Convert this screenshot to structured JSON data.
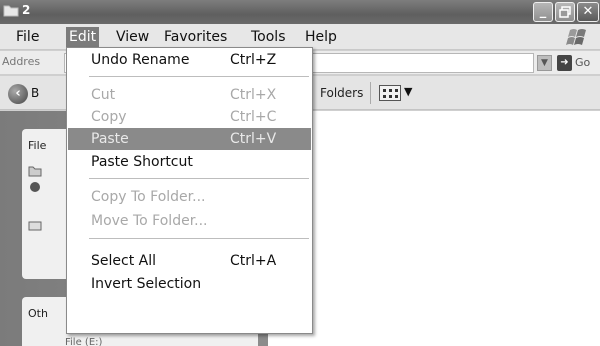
{
  "window": {
    "title": "2"
  },
  "menubar": {
    "items": [
      "File",
      "Edit",
      "View",
      "Favorites",
      "Tools",
      "Help"
    ],
    "active": "Edit"
  },
  "address": {
    "label": "Addres",
    "value": "",
    "go_label": "Go"
  },
  "toolbar": {
    "back_label": "B",
    "folders_label": "Folders"
  },
  "left_pane": {
    "file_tasks_header": "File",
    "other_places_header": "Oth",
    "drive_label": "File (E:)"
  },
  "edit_menu": {
    "items": [
      {
        "label": "Undo Rename",
        "shortcut": "Ctrl+Z",
        "enabled": true
      },
      {
        "label": "Cut",
        "shortcut": "Ctrl+X",
        "enabled": false
      },
      {
        "label": "Copy",
        "shortcut": "Ctrl+C",
        "enabled": false
      },
      {
        "label": "Paste",
        "shortcut": "Ctrl+V",
        "enabled": true,
        "highlighted": true
      },
      {
        "label": "Paste Shortcut",
        "shortcut": "",
        "enabled": true
      },
      {
        "label": "Copy To Folder...",
        "shortcut": "",
        "enabled": false
      },
      {
        "label": "Move To Folder...",
        "shortcut": "",
        "enabled": false
      },
      {
        "label": "Select All",
        "shortcut": "Ctrl+A",
        "enabled": true
      },
      {
        "label": "Invert Selection",
        "shortcut": "",
        "enabled": true
      }
    ]
  },
  "icons": {
    "title": "folder-icon",
    "min": "minimize-icon",
    "max": "maximize-icon",
    "close": "close-icon",
    "back": "back-arrow-icon",
    "views": "views-icon",
    "go": "go-arrow-icon"
  }
}
